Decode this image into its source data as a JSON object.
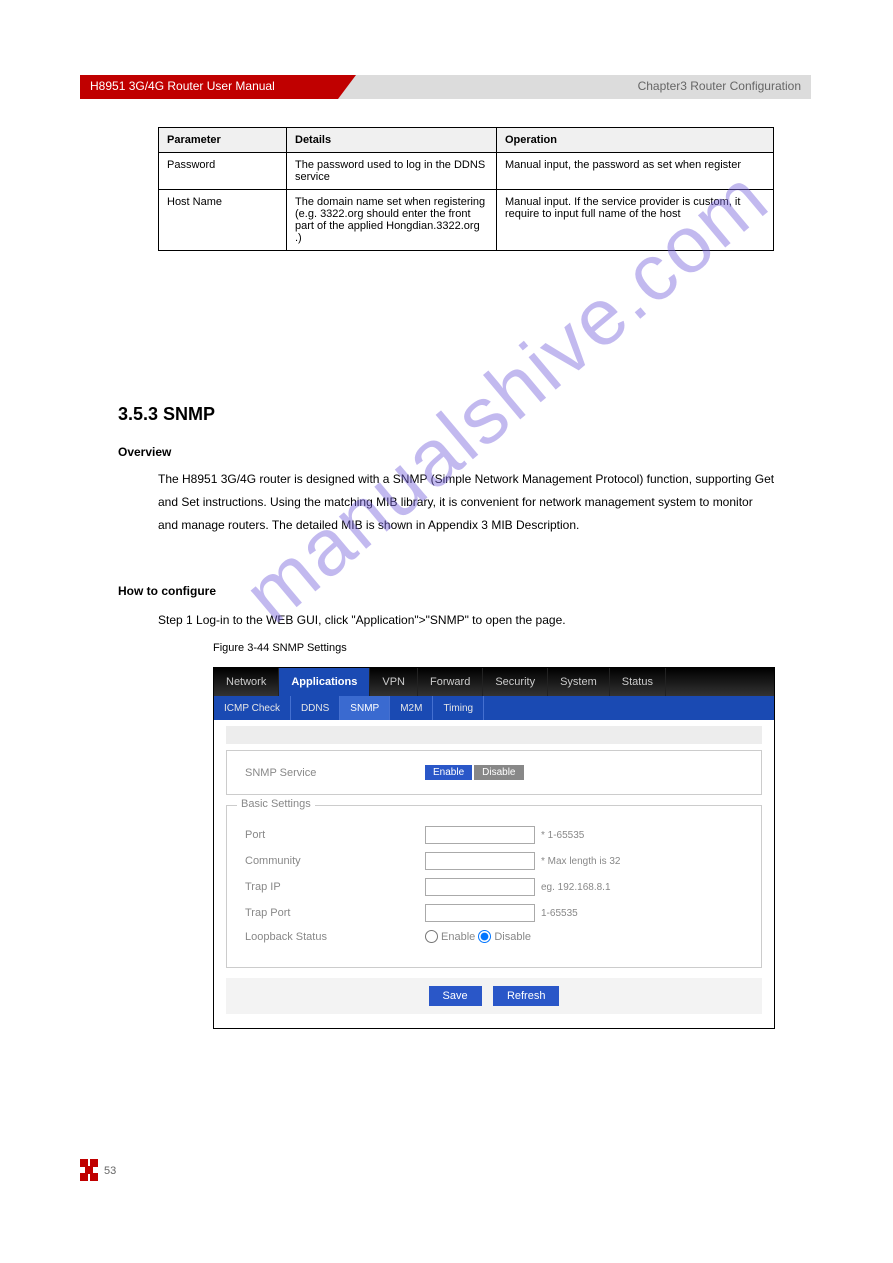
{
  "header": {
    "left": "H8951 3G/4G Router User Manual",
    "right": "Chapter3 Router Configuration"
  },
  "table": {
    "headers": [
      "Parameter",
      "Details",
      "Operation"
    ],
    "rows": [
      {
        "param": "Password",
        "details": "The password used to log in the DDNS service",
        "operation": "Manual input, the password as set when register"
      },
      {
        "param": "Host Name",
        "details": "The domain name set when registering (e.g. 3322.org should enter the front part of the applied Hongdian.3322.org .)",
        "operation": "Manual input. If the service provider is custom, it require to input full name of the host"
      }
    ]
  },
  "section": {
    "number_title": "3.5.3 SNMP",
    "overview_label": "Overview",
    "overview_text": "The H8951 3G/4G router is designed with a SNMP (Simple Network Management Protocol) function, supporting Get and Set instructions. Using the matching MIB library, it is convenient for network management system to monitor and manage routers. The detailed MIB is shown in Appendix 3 MIB Description.",
    "config_label": "How to configure",
    "step_text": "Step 1  Log-in to the WEB GUI, click \"Application\">\"SNMP\" to open the page.",
    "figure_label": "Figure 3-44",
    "figure_text": " SNMP Settings"
  },
  "screenshot": {
    "main_tabs": [
      "Network",
      "Applications",
      "VPN",
      "Forward",
      "Security",
      "System",
      "Status"
    ],
    "main_active_index": 1,
    "sub_tabs": [
      "ICMP Check",
      "DDNS",
      "SNMP",
      "M2M",
      "Timing"
    ],
    "sub_active_index": 2,
    "snmp_service_label": "SNMP Service",
    "enable": "Enable",
    "disable": "Disable",
    "fieldset_title": "Basic Settings",
    "rows": {
      "port": {
        "label": "Port",
        "hint": "* 1-65535"
      },
      "community": {
        "label": "Community",
        "hint": "* Max length is 32"
      },
      "trap_ip": {
        "label": "Trap IP",
        "hint": "eg. 192.168.8.1"
      },
      "trap_port": {
        "label": "Trap Port",
        "hint": "1-65535"
      },
      "loopback": {
        "label": "Loopback Status"
      }
    },
    "loopback_enable": "Enable",
    "loopback_disable": "Disable",
    "buttons": {
      "save": "Save",
      "refresh": "Refresh"
    }
  },
  "footer": {
    "page": "53"
  },
  "watermark": "manualshive.com"
}
